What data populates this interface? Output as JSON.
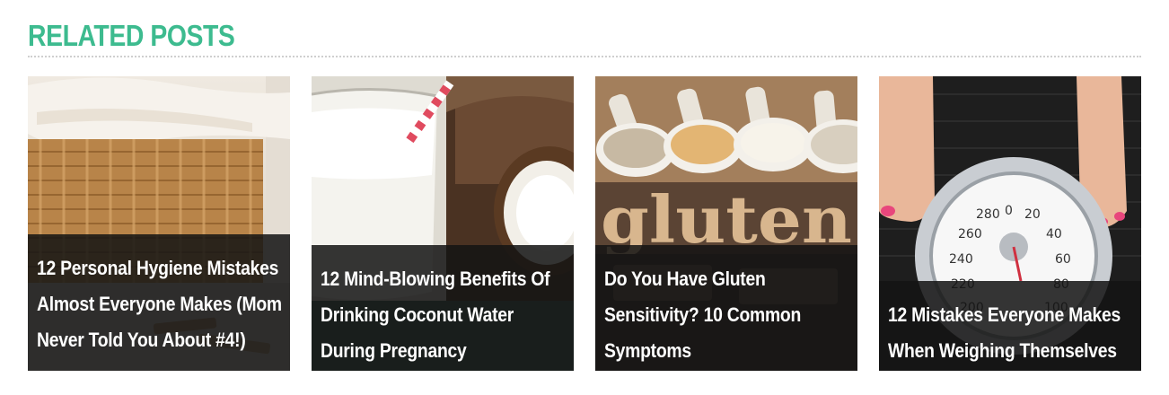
{
  "section": {
    "title": "RELATED POSTS",
    "accent_color": "#3dbb8f"
  },
  "posts": [
    {
      "title": "12 Personal Hygiene Mistakes Almost Everyone Makes (Mom Never Told You About #4!)",
      "image": "laundry-basket-photo"
    },
    {
      "title": "12 Mind-Blowing Benefits Of Drinking Coconut Water During Pregnancy",
      "image": "coconut-water-glass-photo"
    },
    {
      "title": "Do You Have Gluten Sensitivity? 10 Common Symptoms",
      "image": "gluten-flour-scoops-photo"
    },
    {
      "title": "12 Mistakes Everyone Makes When Weighing Themselves",
      "image": "bathroom-scale-feet-photo"
    }
  ]
}
